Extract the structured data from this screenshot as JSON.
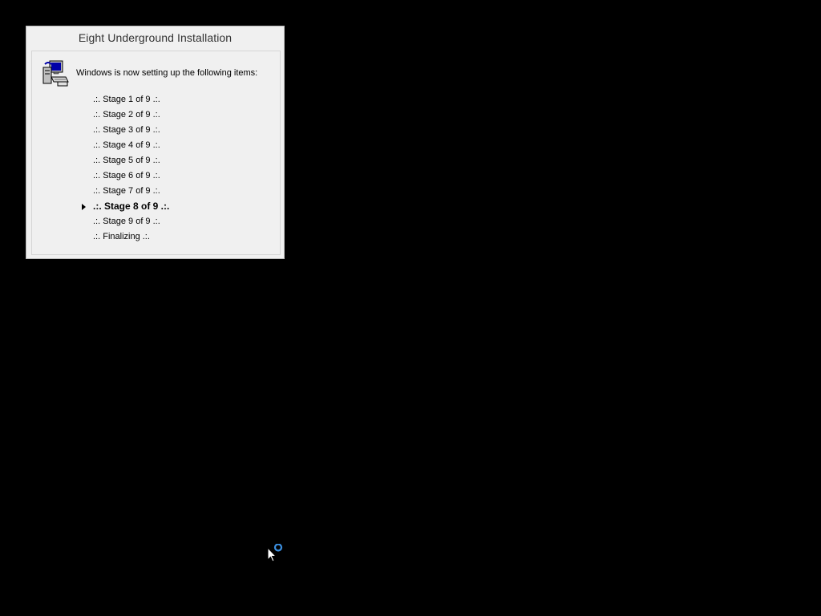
{
  "window": {
    "title": "Eight Underground Installation"
  },
  "content": {
    "intro_text": "Windows is now setting up the following items:",
    "icon": "computer-setup-icon",
    "current_indicator_icon": "triangle-right-icon"
  },
  "stages": [
    {
      "label": ".:. Stage 1 of 9 .:.",
      "active": false
    },
    {
      "label": ".:. Stage 2 of 9 .:.",
      "active": false
    },
    {
      "label": ".:. Stage 3 of 9 .:.",
      "active": false
    },
    {
      "label": ".:. Stage 4 of 9 .:.",
      "active": false
    },
    {
      "label": ".:. Stage 5 of 9 .:.",
      "active": false
    },
    {
      "label": ".:. Stage 6 of 9 .:.",
      "active": false
    },
    {
      "label": ".:. Stage 7 of 9 .:.",
      "active": false
    },
    {
      "label": ".:. Stage 8 of 9 .:.",
      "active": true
    },
    {
      "label": ".:. Stage 9 of 9 .:.",
      "active": false
    },
    {
      "label": ".:. Finalizing .:.",
      "active": false
    }
  ],
  "cursor": {
    "icon": "busy-pointer-icon"
  },
  "colors": {
    "desktop": "#000000",
    "window": "#f0f0f0",
    "busy_ring": "#3b8fe0"
  }
}
